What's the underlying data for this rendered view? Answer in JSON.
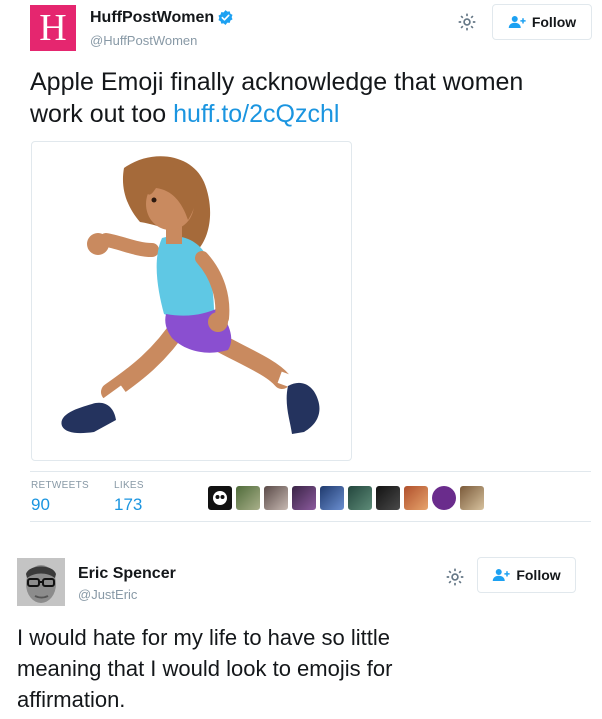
{
  "tweet1": {
    "logo_letter": "H",
    "name": "HuffPostWomen",
    "handle": "@HuffPostWomen",
    "follow_label": "Follow",
    "text": "Apple Emoji finally acknowledge that women work out too",
    "link_text": "huff.to/2cQzchl",
    "stats": {
      "retweets_label": "RETWEETS",
      "retweets_value": "90",
      "likes_label": "LIKES",
      "likes_value": "173"
    }
  },
  "tweet2": {
    "name": "Eric Spencer",
    "handle": "@JustEric",
    "follow_label": "Follow",
    "text_line1": "I would hate for my life to have so little",
    "text_line2": "meaning that I would look to emojis for",
    "text_line3": "affirmation."
  },
  "colors": {
    "huffpost_pink": "#e5266f",
    "link_blue": "#1b95e0",
    "verified_blue": "#1da1f2",
    "muted_gray": "#8899a6",
    "border_gray": "#e1e8ed"
  },
  "icons": [
    "verified-badge-icon",
    "gear-icon",
    "follow-person-plus-icon",
    "running-woman-emoji-icon"
  ]
}
